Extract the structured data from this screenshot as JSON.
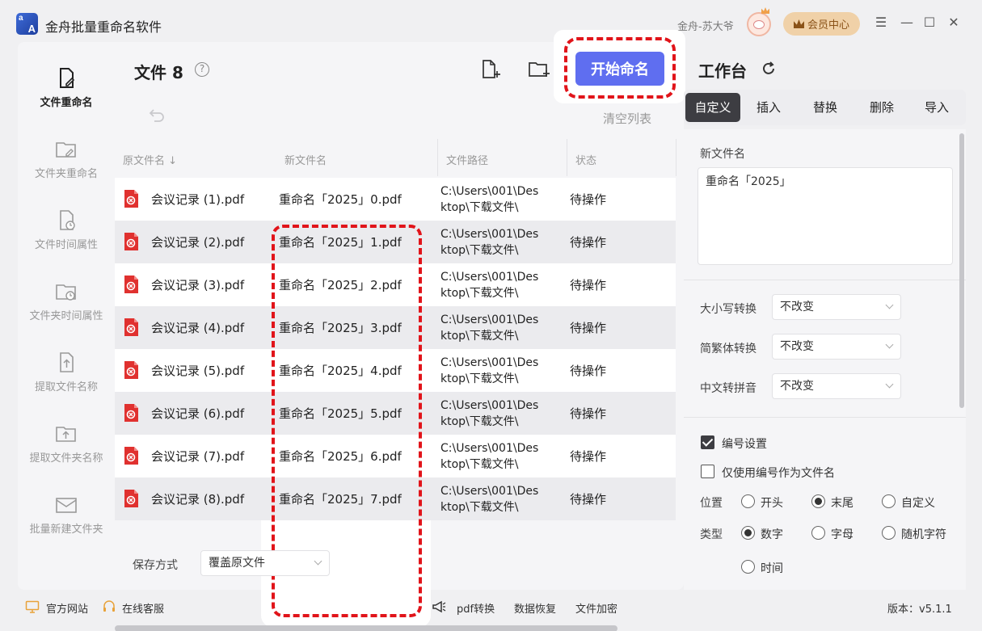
{
  "app": {
    "title": "金舟批量重命名软件",
    "user_name": "金舟-苏大爷",
    "vip_label": "会员中心"
  },
  "window_controls": [
    "☰",
    "—",
    "☐",
    "✕"
  ],
  "sidebar": {
    "items": [
      {
        "label": "文件重命名",
        "icon": "file-edit-icon",
        "active": true
      },
      {
        "label": "文件夹重命名",
        "icon": "folder-edit-icon",
        "active": false
      },
      {
        "label": "文件时间属性",
        "icon": "file-clock-icon",
        "active": false
      },
      {
        "label": "文件夹时间属性",
        "icon": "folder-clock-icon",
        "active": false
      },
      {
        "label": "提取文件名称",
        "icon": "file-upload-icon",
        "active": false
      },
      {
        "label": "提取文件夹名称",
        "icon": "folder-upload-icon",
        "active": false
      },
      {
        "label": "批量新建文件夹",
        "icon": "mail-folder-icon",
        "active": false
      }
    ]
  },
  "main": {
    "title": "文件 8",
    "help": "?",
    "start_button": "开始命名",
    "clear_list": "清空列表",
    "columns": [
      "原文件名 ↓",
      "新文件名",
      "文件路径",
      "状态"
    ],
    "rows": [
      {
        "orig": "会议记录 (1).pdf",
        "new": "重命名「2025」0.pdf",
        "path1": "C:\\Users\\001\\Des",
        "path2": "ktop\\下载文件\\",
        "status": "待操作"
      },
      {
        "orig": "会议记录 (2).pdf",
        "new": "重命名「2025」1.pdf",
        "path1": "C:\\Users\\001\\Des",
        "path2": "ktop\\下载文件\\",
        "status": "待操作"
      },
      {
        "orig": "会议记录 (3).pdf",
        "new": "重命名「2025」2.pdf",
        "path1": "C:\\Users\\001\\Des",
        "path2": "ktop\\下载文件\\",
        "status": "待操作"
      },
      {
        "orig": "会议记录 (4).pdf",
        "new": "重命名「2025」3.pdf",
        "path1": "C:\\Users\\001\\Des",
        "path2": "ktop\\下载文件\\",
        "status": "待操作"
      },
      {
        "orig": "会议记录 (5).pdf",
        "new": "重命名「2025」4.pdf",
        "path1": "C:\\Users\\001\\Des",
        "path2": "ktop\\下载文件\\",
        "status": "待操作"
      },
      {
        "orig": "会议记录 (6).pdf",
        "new": "重命名「2025」5.pdf",
        "path1": "C:\\Users\\001\\Des",
        "path2": "ktop\\下载文件\\",
        "status": "待操作"
      },
      {
        "orig": "会议记录 (7).pdf",
        "new": "重命名「2025」6.pdf",
        "path1": "C:\\Users\\001\\Des",
        "path2": "ktop\\下载文件\\",
        "status": "待操作"
      },
      {
        "orig": "会议记录 (8).pdf",
        "new": "重命名「2025」7.pdf",
        "path1": "C:\\Users\\001\\Des",
        "path2": "ktop\\下载文件\\",
        "status": "待操作"
      }
    ],
    "save_label": "保存方式",
    "save_value": "覆盖原文件"
  },
  "workspace": {
    "title": "工作台",
    "tabs": [
      "自定义",
      "插入",
      "替换",
      "删除",
      "导入"
    ],
    "new_name_label": "新文件名",
    "new_name_value": "重命名「2025」",
    "case_label": "大小写转换",
    "case_value": "不改变",
    "trad_label": "简繁体转换",
    "trad_value": "不改变",
    "pinyin_label": "中文转拼音",
    "pinyin_value": "不改变",
    "numbering_label": "编号设置",
    "numbering_checked": true,
    "only_number_label": "仅使用编号作为文件名",
    "only_number_checked": false,
    "position_label": "位置",
    "position_options": [
      "开头",
      "末尾",
      "自定义"
    ],
    "position_selected": "末尾",
    "type_label": "类型",
    "type_options": [
      "数字",
      "字母",
      "随机字符",
      "时间"
    ],
    "type_selected": "数字"
  },
  "footer": {
    "website": "官方网站",
    "service": "在线客服",
    "pdf": "pdf转换",
    "recovery": "数据恢复",
    "encrypt": "文件加密",
    "version": "版本：v5.1.1"
  },
  "colors": {
    "accent": "#5f6ef0",
    "highlight": "#e1141a",
    "vip_bg": "#f0d1a8",
    "pdf_red": "#e0312f"
  }
}
